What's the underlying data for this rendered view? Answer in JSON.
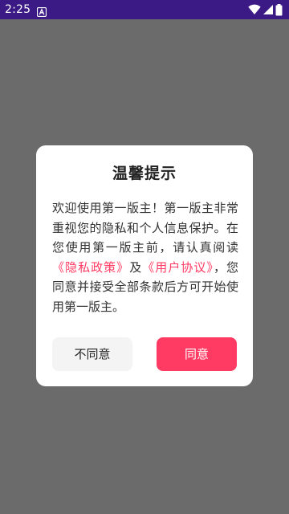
{
  "status_bar": {
    "time": "2:25",
    "icons": [
      "notification-a-icon",
      "wifi-icon",
      "cell-signal-icon",
      "battery-icon"
    ],
    "background": "#3b1a86"
  },
  "dialog": {
    "title": "温馨提示",
    "body": {
      "text_1": "欢迎使用第一版主！第一版主非常重视您的隐私和个人信息保护。在您使用第一版主前，请认真阅读",
      "privacy_link": "《隐私政策》",
      "text_2": "及",
      "agreement_link": "《用户协议》",
      "text_3": "，您同意并接受全部条款后方可开始使用第一版主。"
    },
    "decline_label": "不同意",
    "agree_label": "同意"
  },
  "colors": {
    "accent": "#ff3b63",
    "overlay": "#6b6b6b",
    "dialog_bg": "#ffffff",
    "decline_bg": "#f4f4f4"
  }
}
